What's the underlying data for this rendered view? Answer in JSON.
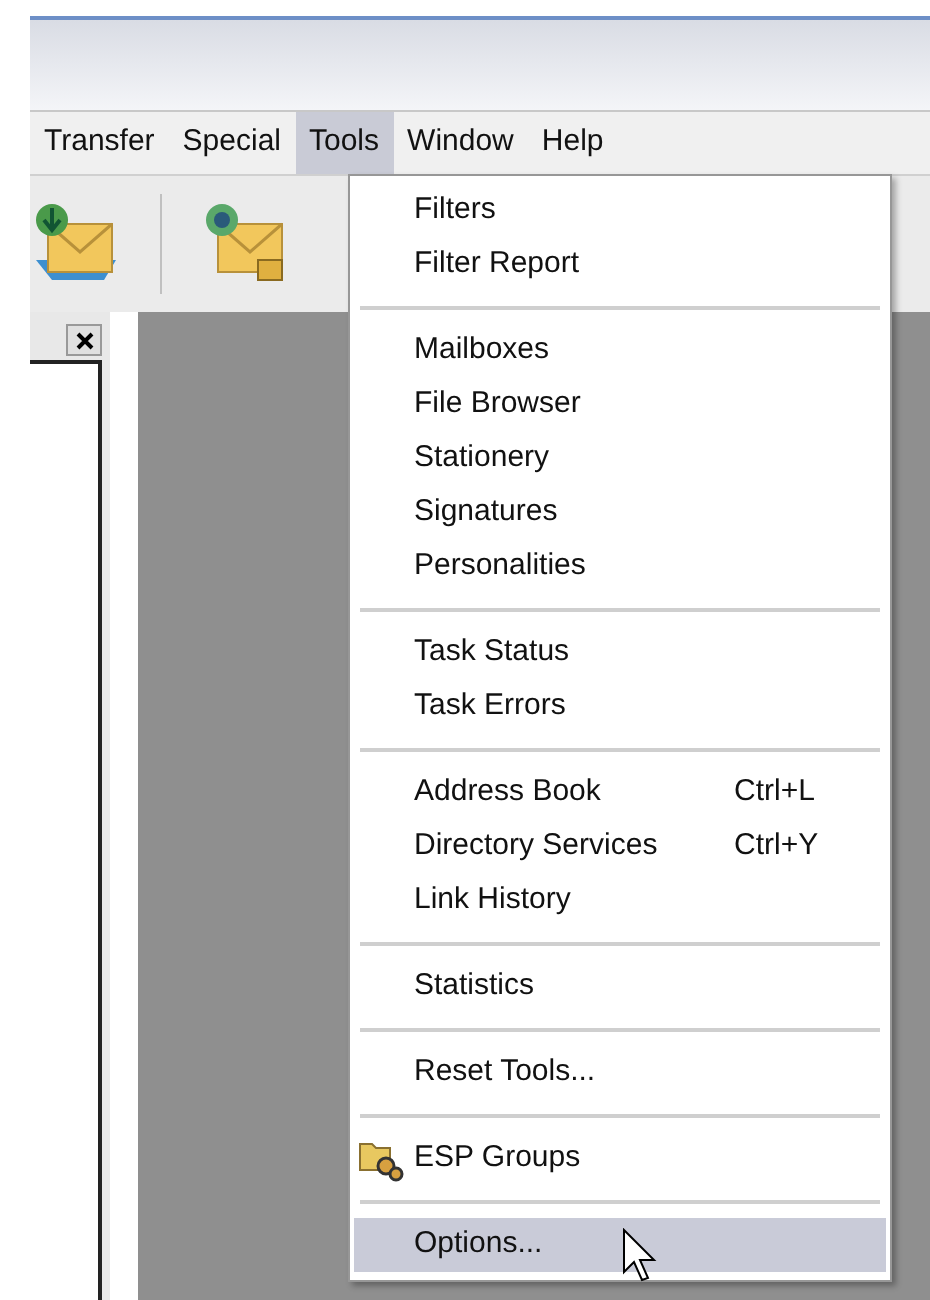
{
  "menu_bar": [
    {
      "label": "Transfer",
      "selected": false
    },
    {
      "label": "Special",
      "selected": false
    },
    {
      "label": "Tools",
      "selected": true
    },
    {
      "label": "Window",
      "selected": false
    },
    {
      "label": "Help",
      "selected": false
    }
  ],
  "tools_menu": {
    "groups": [
      {
        "items": [
          {
            "label": "Filters",
            "kind": "plain",
            "selected": false
          },
          {
            "label": "Filter Report",
            "kind": "plain",
            "selected": false
          }
        ]
      },
      {
        "items": [
          {
            "label": "Mailboxes",
            "kind": "plain",
            "selected": false
          },
          {
            "label": "File Browser",
            "kind": "plain",
            "selected": false
          },
          {
            "label": "Stationery",
            "kind": "plain",
            "selected": false
          },
          {
            "label": "Signatures",
            "kind": "plain",
            "selected": false
          },
          {
            "label": "Personalities",
            "kind": "plain",
            "selected": false
          }
        ]
      },
      {
        "items": [
          {
            "label": "Task Status",
            "kind": "plain",
            "selected": false
          },
          {
            "label": "Task Errors",
            "kind": "plain",
            "selected": false
          }
        ]
      },
      {
        "items": [
          {
            "label": "Address Book",
            "shortcut": "Ctrl+L",
            "kind": "plain",
            "selected": false
          },
          {
            "label": "Directory Services",
            "shortcut": "Ctrl+Y",
            "kind": "plain",
            "selected": false
          },
          {
            "label": "Link History",
            "kind": "plain",
            "selected": false
          }
        ]
      },
      {
        "items": [
          {
            "label": "Statistics",
            "kind": "plain",
            "selected": false
          }
        ]
      },
      {
        "items": [
          {
            "label": "Reset Tools...",
            "kind": "plain",
            "selected": false
          }
        ]
      },
      {
        "items": [
          {
            "label": "ESP Groups",
            "kind": "icon",
            "selected": false
          }
        ]
      },
      {
        "items": [
          {
            "label": "Options...",
            "kind": "plain",
            "selected": true
          }
        ]
      }
    ]
  }
}
